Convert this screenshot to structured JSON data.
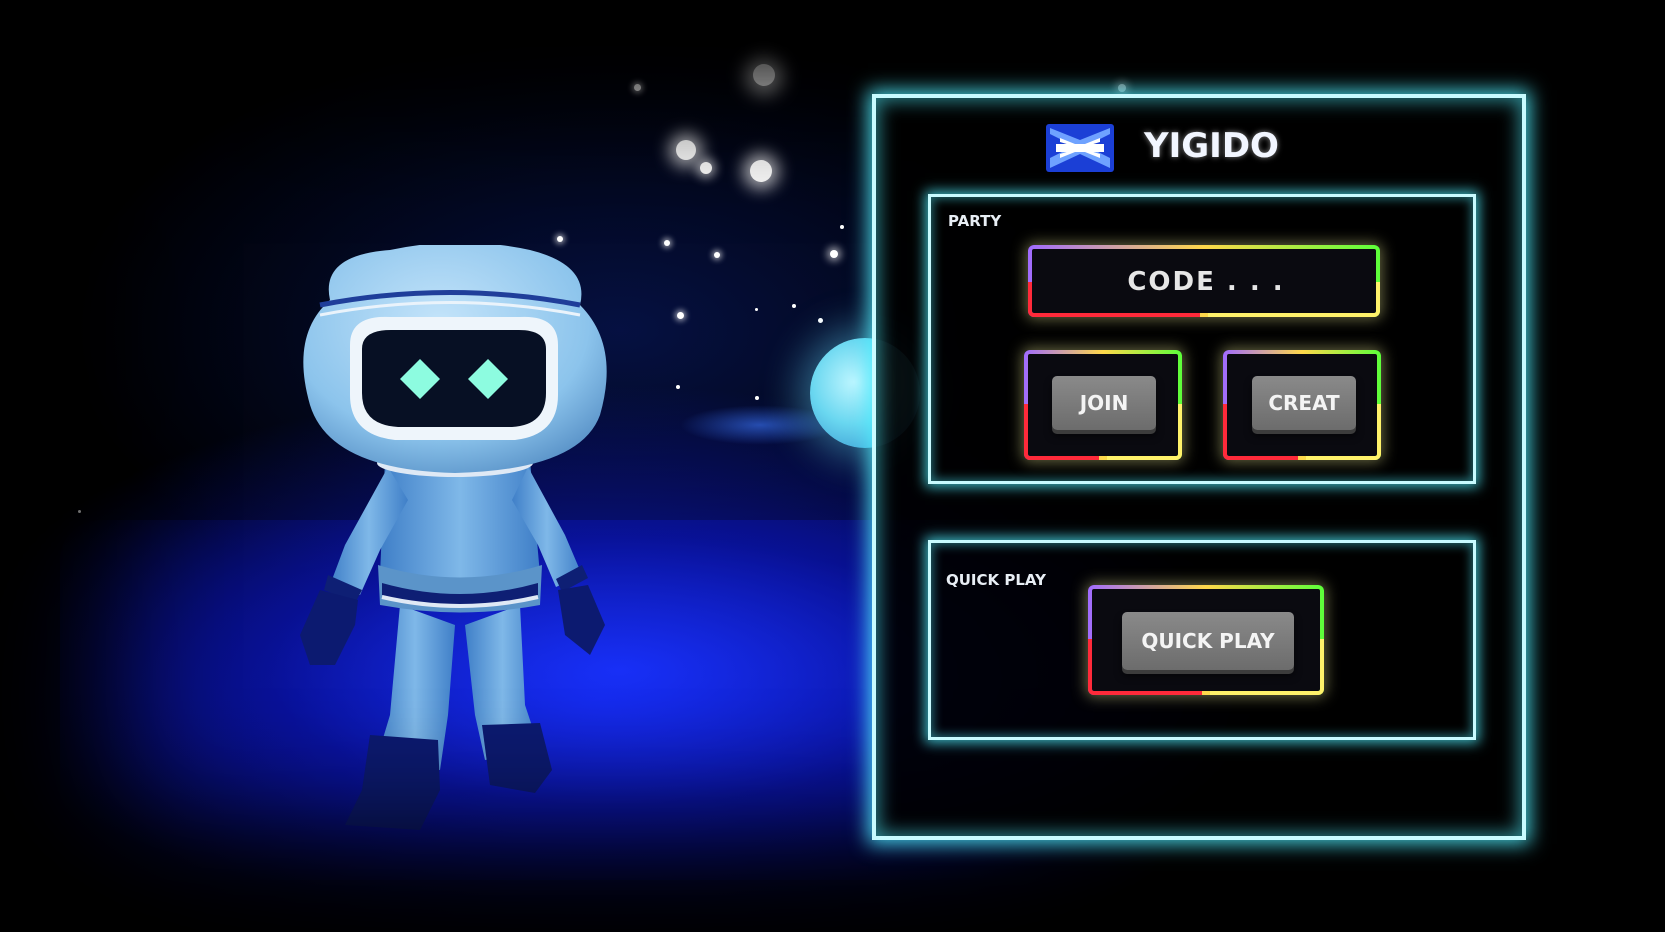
{
  "game": {
    "title": "YIGIDO"
  },
  "party": {
    "label": "PARTY",
    "code_placeholder": "CODE . . .",
    "code_value": "",
    "join_label": "JOIN",
    "create_label": "CREAT"
  },
  "quick_play": {
    "label": "QUICK PLAY",
    "button_label": "QUICK PLAY"
  },
  "colors": {
    "panel_border": "#c8fbff",
    "panel_glow": "#50f0ff",
    "neon_purple": "#a06bff",
    "neon_yellow": "#ffd84a",
    "neon_green": "#5cff3a",
    "neon_red": "#ff2a3a",
    "button_gray": "#7a7a7a",
    "scene_blue": "#1428e6"
  },
  "icons": {
    "logo": "yigido-logo-icon"
  }
}
